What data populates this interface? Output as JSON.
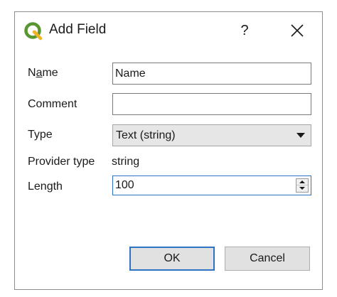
{
  "dialog": {
    "title": "Add Field",
    "help_label": "?",
    "icons": {
      "app": "qgis-logo-icon",
      "close": "close-icon"
    },
    "accent_color": "#2e72c4",
    "brand_color": "#589632"
  },
  "form": {
    "name": {
      "label_prefix": "N",
      "label_mnemonic": "a",
      "label_suffix": "me",
      "value": "Name"
    },
    "comment": {
      "label": "Comment",
      "value": ""
    },
    "type": {
      "label": "Type",
      "selected": "Text (string)"
    },
    "provider_type": {
      "label": "Provider type",
      "value": "string"
    },
    "length": {
      "label": "Length",
      "value": "100"
    }
  },
  "buttons": {
    "ok": "OK",
    "cancel": "Cancel"
  }
}
